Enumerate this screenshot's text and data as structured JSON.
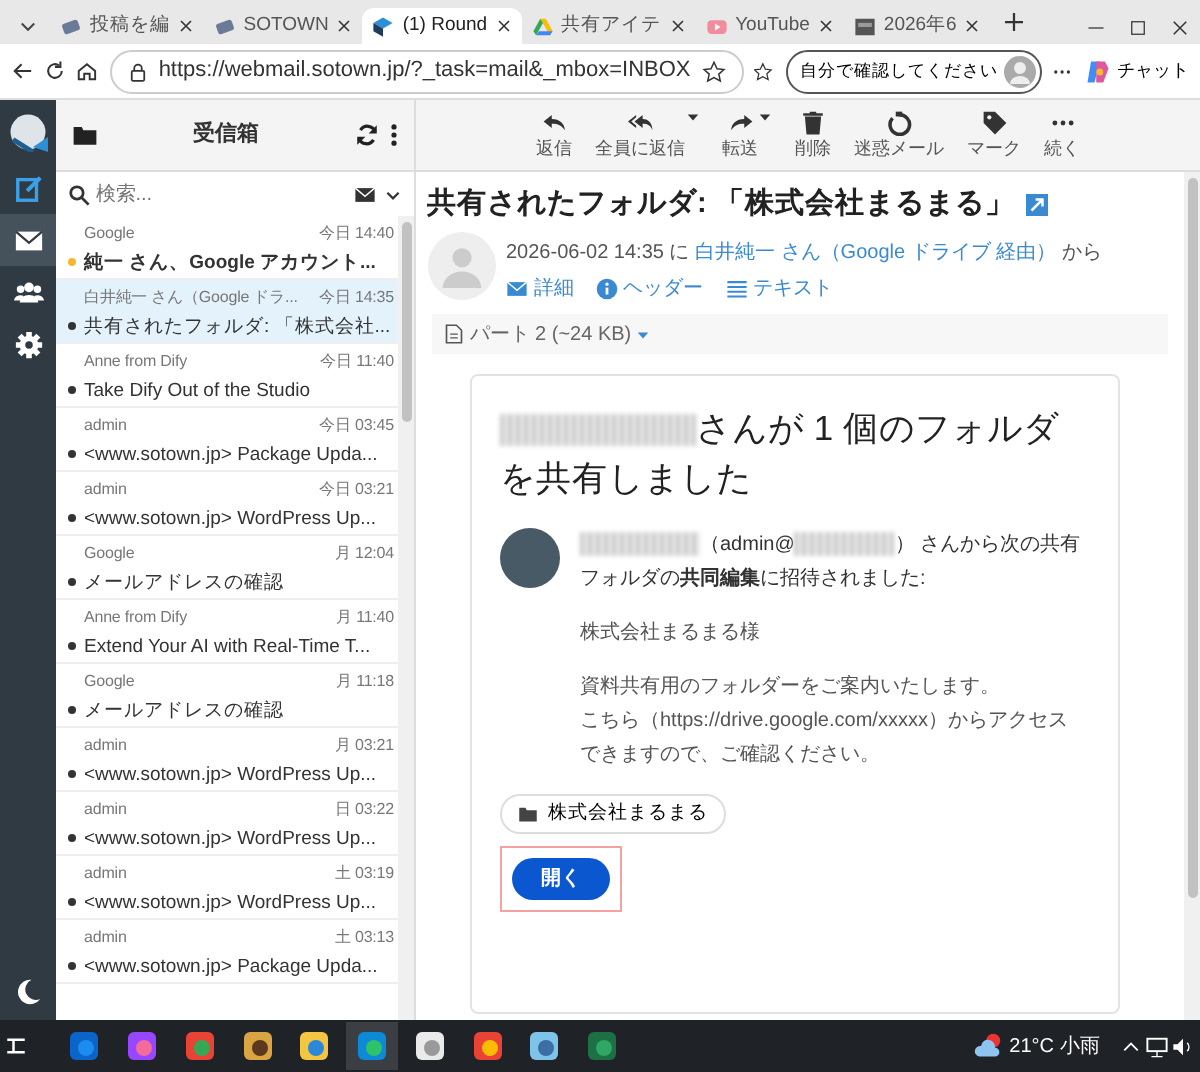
{
  "browser": {
    "tabs": [
      {
        "label": "投稿を編",
        "selected": false
      },
      {
        "label": "SOTOWN",
        "selected": false
      },
      {
        "label": "(1) Round",
        "selected": true
      },
      {
        "label": "共有アイテ",
        "selected": false
      },
      {
        "label": "YouTube",
        "selected": false
      },
      {
        "label": "2026年6",
        "selected": false
      }
    ],
    "url": "https://webmail.sotown.jp/?_task=mail&_mbox=INBOX",
    "profile_label": "自分で確認してください",
    "chat_label": "チャット"
  },
  "sidebar": {
    "items": [
      {
        "selected": false
      },
      {
        "selected": true
      },
      {
        "selected": false
      },
      {
        "selected": false
      }
    ]
  },
  "folder": {
    "title": "受信箱",
    "search_placeholder": "検索..."
  },
  "messages": [
    {
      "sender": "Google",
      "time": "今日 14:40",
      "subject": "純一 さん、Google アカウント...",
      "unread": true,
      "selected": false
    },
    {
      "sender": "白井純一 さん（Google ドラ...",
      "time": "今日 14:35",
      "subject": "共有されたフォルダ: 「株式会社...",
      "unread": false,
      "selected": true
    },
    {
      "sender": "Anne from Dify",
      "time": "今日 11:40",
      "subject": "Take Dify Out of the Studio",
      "unread": false,
      "selected": false
    },
    {
      "sender": "admin",
      "time": "今日 03:45",
      "subject": "<www.sotown.jp> Package Upda...",
      "unread": false,
      "selected": false
    },
    {
      "sender": "admin",
      "time": "今日 03:21",
      "subject": "<www.sotown.jp> WordPress Up...",
      "unread": false,
      "selected": false
    },
    {
      "sender": "Google",
      "time": "月 12:04",
      "subject": "メールアドレスの確認",
      "unread": false,
      "selected": false
    },
    {
      "sender": "Anne from Dify",
      "time": "月 11:40",
      "subject": "Extend Your AI with Real-Time T...",
      "unread": false,
      "selected": false
    },
    {
      "sender": "Google",
      "time": "月 11:18",
      "subject": "メールアドレスの確認",
      "unread": false,
      "selected": false
    },
    {
      "sender": "admin",
      "time": "月 03:21",
      "subject": "<www.sotown.jp> WordPress Up...",
      "unread": false,
      "selected": false
    },
    {
      "sender": "admin",
      "time": "日 03:22",
      "subject": "<www.sotown.jp> WordPress Up...",
      "unread": false,
      "selected": false
    },
    {
      "sender": "admin",
      "time": "土 03:19",
      "subject": "<www.sotown.jp> WordPress Up...",
      "unread": false,
      "selected": false
    },
    {
      "sender": "admin",
      "time": "土 03:13",
      "subject": "<www.sotown.jp> Package Upda...",
      "unread": false,
      "selected": false
    }
  ],
  "toolbar": [
    {
      "label": "返信",
      "has_menu": false
    },
    {
      "label": "全員に返信",
      "has_menu": true
    },
    {
      "label": "転送",
      "has_menu": true
    },
    {
      "label": "削除",
      "has_menu": false
    },
    {
      "label": "迷惑メール",
      "has_menu": false
    },
    {
      "label": "マーク",
      "has_menu": false
    },
    {
      "label": "続く",
      "has_menu": false
    }
  ],
  "message": {
    "subject": "共有されたフォルダ: 「株式会社まるまる」",
    "date": "2026-06-02 14:35 に",
    "from": "白井純一 さん（Google ドライブ 経由）",
    "from_suffix": "から",
    "header_links": [
      "詳細",
      "ヘッダー",
      "テキスト"
    ],
    "part": "パート 2 (~24 KB)",
    "body": {
      "heading": "さんが 1 個のフォルダを共有しました",
      "invite_prefix": "（admin@",
      "invite_rest": "） さんから次の共有フォルダの**共同編集**に招待されました:",
      "paragraphs": [
        [
          "株式会社まるまる様"
        ],
        [
          "資料共有用のフォルダーをご案内いたします。",
          "こちら（https://drive.google.com/xxxxx）からアクセスできますので、ご確認ください。"
        ]
      ],
      "folder_chip": "株式会社まるまる",
      "open_button": "開く",
      "open_highlighted": true
    }
  },
  "taskbar": {
    "apps": [
      {
        "active": false
      },
      {
        "active": false
      },
      {
        "active": false
      },
      {
        "active": false
      },
      {
        "active": false
      },
      {
        "active": true
      },
      {
        "active": false
      },
      {
        "active": false
      },
      {
        "active": false
      },
      {
        "active": false
      }
    ],
    "temperature": "21°C",
    "weather": "小雨"
  }
}
